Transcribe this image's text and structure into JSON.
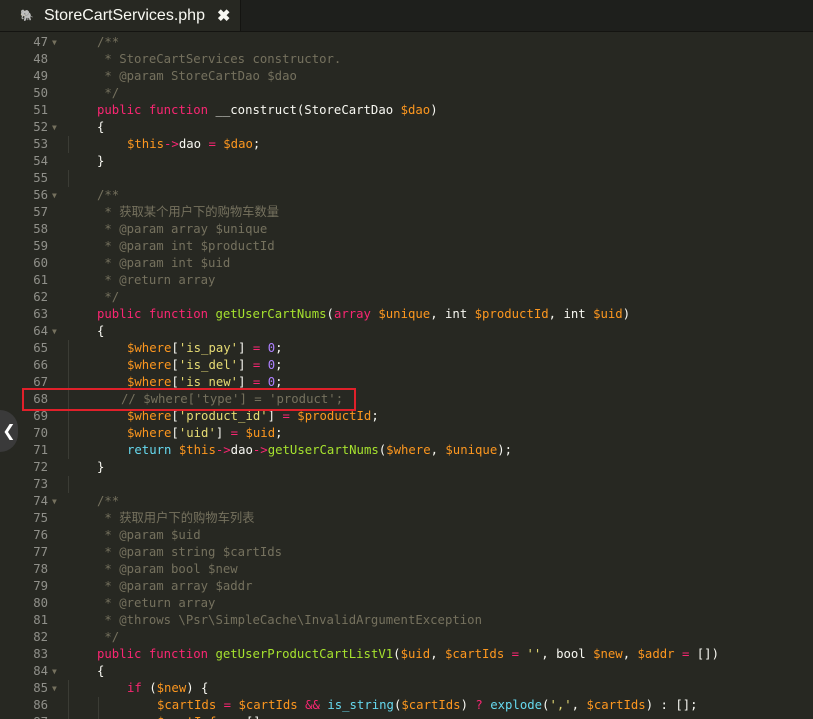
{
  "tab": {
    "icon": "php-elephant-icon",
    "title": "StoreCartServices.php",
    "close_glyph": "✖"
  },
  "collapse_glyph": "❮",
  "watermark": "",
  "colors": {
    "background": "#272822",
    "keyword": "#f92672",
    "type_keyword": "#66d9ef",
    "function_name": "#a6e22e",
    "variable": "#fd971f",
    "string": "#e6db74",
    "comment": "#75715e",
    "number": "#ae81ff",
    "highlight_box": "#e0202a"
  },
  "code": {
    "lines": [
      {
        "n": "47",
        "fold": true,
        "indent": 1,
        "tokens": [
          [
            "c",
            "/**"
          ]
        ]
      },
      {
        "n": "48",
        "fold": false,
        "indent": 1,
        "tokens": [
          [
            "c",
            " * StoreCartServices constructor."
          ]
        ]
      },
      {
        "n": "49",
        "fold": false,
        "indent": 1,
        "tokens": [
          [
            "c",
            " * @param StoreCartDao $dao"
          ]
        ]
      },
      {
        "n": "50",
        "fold": false,
        "indent": 1,
        "tokens": [
          [
            "c",
            " */"
          ]
        ]
      },
      {
        "n": "51",
        "fold": false,
        "indent": 1,
        "tokens": [
          [
            "k",
            "public"
          ],
          [
            "p",
            " "
          ],
          [
            "k",
            "function"
          ],
          [
            "p",
            " __construct(StoreCartDao "
          ],
          [
            "v",
            "$dao"
          ],
          [
            "p",
            ")"
          ]
        ]
      },
      {
        "n": "52",
        "fold": true,
        "indent": 1,
        "tokens": [
          [
            "p",
            "{"
          ]
        ]
      },
      {
        "n": "53",
        "fold": false,
        "indent": 2,
        "tokens": [
          [
            "vt",
            "$this"
          ],
          [
            "arr",
            "->"
          ],
          [
            "p",
            "dao "
          ],
          [
            "o",
            "="
          ],
          [
            "p",
            " "
          ],
          [
            "v",
            "$dao"
          ],
          [
            "p",
            ";"
          ]
        ]
      },
      {
        "n": "54",
        "fold": false,
        "indent": 1,
        "tokens": [
          [
            "p",
            "}"
          ]
        ]
      },
      {
        "n": "55",
        "fold": false,
        "indent": 0,
        "tokens": []
      },
      {
        "n": "56",
        "fold": true,
        "indent": 1,
        "tokens": [
          [
            "c",
            "/**"
          ]
        ]
      },
      {
        "n": "57",
        "fold": false,
        "indent": 1,
        "tokens": [
          [
            "c",
            " * 获取某个用户下的购物车数量"
          ]
        ]
      },
      {
        "n": "58",
        "fold": false,
        "indent": 1,
        "tokens": [
          [
            "c",
            " * @param array $unique"
          ]
        ]
      },
      {
        "n": "59",
        "fold": false,
        "indent": 1,
        "tokens": [
          [
            "c",
            " * @param int $productId"
          ]
        ]
      },
      {
        "n": "60",
        "fold": false,
        "indent": 1,
        "tokens": [
          [
            "c",
            " * @param int $uid"
          ]
        ]
      },
      {
        "n": "61",
        "fold": false,
        "indent": 1,
        "tokens": [
          [
            "c",
            " * @return array"
          ]
        ]
      },
      {
        "n": "62",
        "fold": false,
        "indent": 1,
        "tokens": [
          [
            "c",
            " */"
          ]
        ]
      },
      {
        "n": "63",
        "fold": false,
        "indent": 1,
        "tokens": [
          [
            "k",
            "public"
          ],
          [
            "p",
            " "
          ],
          [
            "k",
            "function"
          ],
          [
            "p",
            " "
          ],
          [
            "fn2",
            "getUserCartNums"
          ],
          [
            "p",
            "("
          ],
          [
            "k",
            "array"
          ],
          [
            "p",
            " "
          ],
          [
            "v",
            "$unique"
          ],
          [
            "p",
            ", int "
          ],
          [
            "v",
            "$productId"
          ],
          [
            "p",
            ", int "
          ],
          [
            "v",
            "$uid"
          ],
          [
            "p",
            ")"
          ]
        ]
      },
      {
        "n": "64",
        "fold": true,
        "indent": 1,
        "tokens": [
          [
            "p",
            "{"
          ]
        ]
      },
      {
        "n": "65",
        "fold": false,
        "indent": 2,
        "tokens": [
          [
            "v",
            "$where"
          ],
          [
            "p",
            "["
          ],
          [
            "s",
            "'is_pay'"
          ],
          [
            "p",
            "] "
          ],
          [
            "o",
            "="
          ],
          [
            "p",
            " "
          ],
          [
            "n",
            "0"
          ],
          [
            "p",
            ";"
          ]
        ]
      },
      {
        "n": "66",
        "fold": false,
        "indent": 2,
        "tokens": [
          [
            "v",
            "$where"
          ],
          [
            "p",
            "["
          ],
          [
            "s",
            "'is_del'"
          ],
          [
            "p",
            "] "
          ],
          [
            "o",
            "="
          ],
          [
            "p",
            " "
          ],
          [
            "n",
            "0"
          ],
          [
            "p",
            ";"
          ]
        ]
      },
      {
        "n": "67",
        "fold": false,
        "indent": 2,
        "tokens": [
          [
            "v",
            "$where"
          ],
          [
            "p",
            "["
          ],
          [
            "s",
            "'is_new'"
          ],
          [
            "p",
            "] "
          ],
          [
            "o",
            "="
          ],
          [
            "p",
            " "
          ],
          [
            "n",
            "0"
          ],
          [
            "p",
            ";"
          ]
        ]
      },
      {
        "n": "68",
        "fold": false,
        "indent": 2,
        "offset": -6,
        "tokens": [
          [
            "c",
            "// $where['type'] = 'product';"
          ]
        ]
      },
      {
        "n": "69",
        "fold": false,
        "indent": 2,
        "tokens": [
          [
            "v",
            "$where"
          ],
          [
            "p",
            "["
          ],
          [
            "s",
            "'product_id'"
          ],
          [
            "p",
            "] "
          ],
          [
            "o",
            "="
          ],
          [
            "p",
            " "
          ],
          [
            "v",
            "$productId"
          ],
          [
            "p",
            ";"
          ]
        ]
      },
      {
        "n": "70",
        "fold": false,
        "indent": 2,
        "tokens": [
          [
            "v",
            "$where"
          ],
          [
            "p",
            "["
          ],
          [
            "s",
            "'uid'"
          ],
          [
            "p",
            "] "
          ],
          [
            "o",
            "="
          ],
          [
            "p",
            " "
          ],
          [
            "v",
            "$uid"
          ],
          [
            "p",
            ";"
          ]
        ]
      },
      {
        "n": "71",
        "fold": false,
        "indent": 2,
        "tokens": [
          [
            "kw",
            "return"
          ],
          [
            "p",
            " "
          ],
          [
            "vt",
            "$this"
          ],
          [
            "arr",
            "->"
          ],
          [
            "p",
            "dao"
          ],
          [
            "arr",
            "->"
          ],
          [
            "fn2",
            "getUserCartNums"
          ],
          [
            "p",
            "("
          ],
          [
            "v",
            "$where"
          ],
          [
            "p",
            ", "
          ],
          [
            "v",
            "$unique"
          ],
          [
            "p",
            ");"
          ]
        ]
      },
      {
        "n": "72",
        "fold": false,
        "indent": 1,
        "tokens": [
          [
            "p",
            "}"
          ]
        ]
      },
      {
        "n": "73",
        "fold": false,
        "indent": 0,
        "tokens": []
      },
      {
        "n": "74",
        "fold": true,
        "indent": 1,
        "tokens": [
          [
            "c",
            "/**"
          ]
        ]
      },
      {
        "n": "75",
        "fold": false,
        "indent": 1,
        "tokens": [
          [
            "c",
            " * 获取用户下的购物车列表"
          ]
        ]
      },
      {
        "n": "76",
        "fold": false,
        "indent": 1,
        "tokens": [
          [
            "c",
            " * @param $uid"
          ]
        ]
      },
      {
        "n": "77",
        "fold": false,
        "indent": 1,
        "tokens": [
          [
            "c",
            " * @param string $cartIds"
          ]
        ]
      },
      {
        "n": "78",
        "fold": false,
        "indent": 1,
        "tokens": [
          [
            "c",
            " * @param bool $new"
          ]
        ]
      },
      {
        "n": "79",
        "fold": false,
        "indent": 1,
        "tokens": [
          [
            "c",
            " * @param array $addr"
          ]
        ]
      },
      {
        "n": "80",
        "fold": false,
        "indent": 1,
        "tokens": [
          [
            "c",
            " * @return array"
          ]
        ]
      },
      {
        "n": "81",
        "fold": false,
        "indent": 1,
        "tokens": [
          [
            "c",
            " * @throws \\Psr\\SimpleCache\\InvalidArgumentException"
          ]
        ]
      },
      {
        "n": "82",
        "fold": false,
        "indent": 1,
        "tokens": [
          [
            "c",
            " */"
          ]
        ]
      },
      {
        "n": "83",
        "fold": false,
        "indent": 1,
        "tokens": [
          [
            "k",
            "public"
          ],
          [
            "p",
            " "
          ],
          [
            "k",
            "function"
          ],
          [
            "p",
            " "
          ],
          [
            "fn2",
            "getUserProductCartListV1"
          ],
          [
            "p",
            "("
          ],
          [
            "v",
            "$uid"
          ],
          [
            "p",
            ", "
          ],
          [
            "v",
            "$cartIds"
          ],
          [
            "p",
            " "
          ],
          [
            "o",
            "="
          ],
          [
            "p",
            " "
          ],
          [
            "s",
            "''"
          ],
          [
            "p",
            ", bool "
          ],
          [
            "v",
            "$new"
          ],
          [
            "p",
            ", "
          ],
          [
            "v",
            "$addr"
          ],
          [
            "p",
            " "
          ],
          [
            "o",
            "="
          ],
          [
            "p",
            " [])"
          ]
        ]
      },
      {
        "n": "84",
        "fold": true,
        "indent": 1,
        "tokens": [
          [
            "p",
            "{"
          ]
        ]
      },
      {
        "n": "85",
        "fold": true,
        "indent": 2,
        "tokens": [
          [
            "k",
            "if"
          ],
          [
            "p",
            " ("
          ],
          [
            "v",
            "$new"
          ],
          [
            "p",
            ") {"
          ]
        ]
      },
      {
        "n": "86",
        "fold": false,
        "indent": 3,
        "tokens": [
          [
            "v",
            "$cartIds"
          ],
          [
            "p",
            " "
          ],
          [
            "o",
            "="
          ],
          [
            "p",
            " "
          ],
          [
            "v",
            "$cartIds"
          ],
          [
            "p",
            " "
          ],
          [
            "o",
            "&&"
          ],
          [
            "p",
            " "
          ],
          [
            "kw",
            "is_string"
          ],
          [
            "p",
            "("
          ],
          [
            "v",
            "$cartIds"
          ],
          [
            "p",
            ") "
          ],
          [
            "o",
            "?"
          ],
          [
            "p",
            " "
          ],
          [
            "kw",
            "explode"
          ],
          [
            "p",
            "("
          ],
          [
            "s",
            "','"
          ],
          [
            "p",
            ", "
          ],
          [
            "v",
            "$cartIds"
          ],
          [
            "p",
            ") : [];"
          ]
        ]
      },
      {
        "n": "87",
        "fold": false,
        "indent": 3,
        "tokens": [
          [
            "v",
            "$cartInfo"
          ],
          [
            "p",
            " "
          ],
          [
            "o",
            "="
          ],
          [
            "p",
            " [];"
          ]
        ]
      }
    ]
  }
}
